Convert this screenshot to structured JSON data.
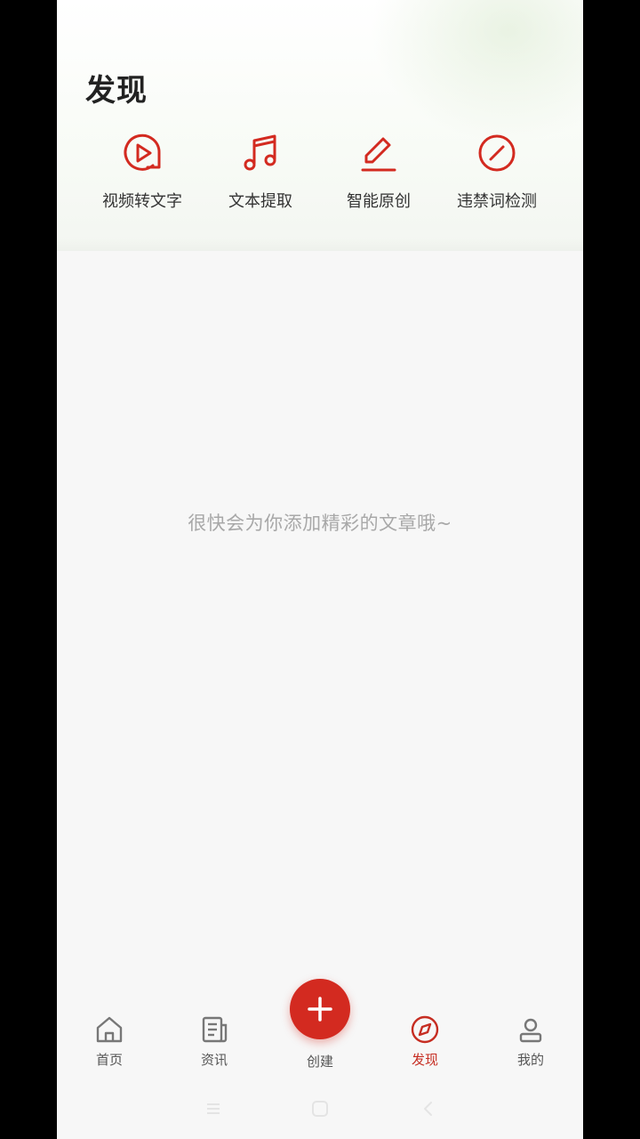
{
  "page": {
    "title": "发现"
  },
  "tools": [
    {
      "label": "视频转文字",
      "icon": "play-video-icon"
    },
    {
      "label": "文本提取",
      "icon": "music-note-icon"
    },
    {
      "label": "智能原创",
      "icon": "pencil-icon"
    },
    {
      "label": "违禁词检测",
      "icon": "forbidden-icon"
    }
  ],
  "empty_message": "很快会为你添加精彩的文章哦~",
  "tabbar": {
    "home": "首页",
    "news": "资讯",
    "create": "创建",
    "discover": "发现",
    "mine": "我的"
  },
  "colors": {
    "accent": "#d32a20",
    "active_tab": "#c62d22"
  }
}
